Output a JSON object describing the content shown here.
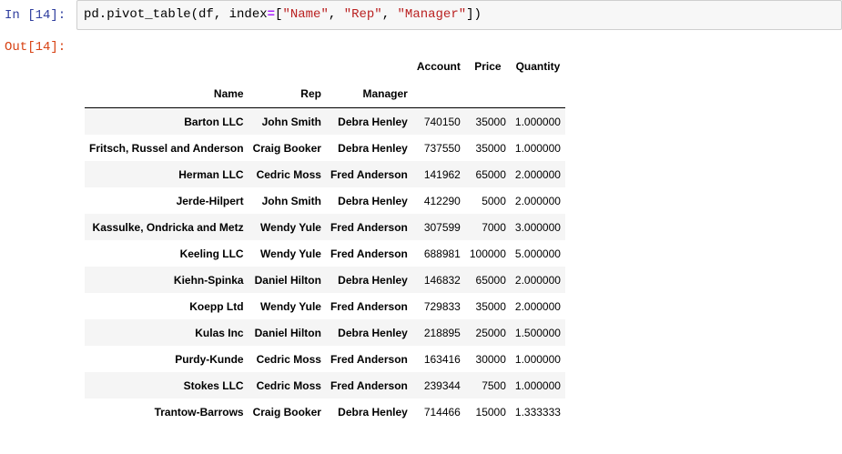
{
  "cell": {
    "in_prompt": "In [14]:",
    "out_prompt": "Out[14]:",
    "code": {
      "t1": "pd.pivot_table(df, index",
      "t2": "=",
      "t3": "[",
      "t4": "\"Name\"",
      "t5": ", ",
      "t6": "\"Rep\"",
      "t7": ", ",
      "t8": "\"Manager\"",
      "t9": "])"
    }
  },
  "table": {
    "value_columns": [
      "Account",
      "Price",
      "Quantity"
    ],
    "index_names": [
      "Name",
      "Rep",
      "Manager"
    ],
    "rows": [
      {
        "name": "Barton LLC",
        "rep": "John Smith",
        "manager": "Debra Henley",
        "account": "740150",
        "price": "35000",
        "quantity": "1.000000"
      },
      {
        "name": "Fritsch, Russel and Anderson",
        "rep": "Craig Booker",
        "manager": "Debra Henley",
        "account": "737550",
        "price": "35000",
        "quantity": "1.000000"
      },
      {
        "name": "Herman LLC",
        "rep": "Cedric Moss",
        "manager": "Fred Anderson",
        "account": "141962",
        "price": "65000",
        "quantity": "2.000000"
      },
      {
        "name": "Jerde-Hilpert",
        "rep": "John Smith",
        "manager": "Debra Henley",
        "account": "412290",
        "price": "5000",
        "quantity": "2.000000"
      },
      {
        "name": "Kassulke, Ondricka and Metz",
        "rep": "Wendy Yule",
        "manager": "Fred Anderson",
        "account": "307599",
        "price": "7000",
        "quantity": "3.000000"
      },
      {
        "name": "Keeling LLC",
        "rep": "Wendy Yule",
        "manager": "Fred Anderson",
        "account": "688981",
        "price": "100000",
        "quantity": "5.000000"
      },
      {
        "name": "Kiehn-Spinka",
        "rep": "Daniel Hilton",
        "manager": "Debra Henley",
        "account": "146832",
        "price": "65000",
        "quantity": "2.000000"
      },
      {
        "name": "Koepp Ltd",
        "rep": "Wendy Yule",
        "manager": "Fred Anderson",
        "account": "729833",
        "price": "35000",
        "quantity": "2.000000"
      },
      {
        "name": "Kulas Inc",
        "rep": "Daniel Hilton",
        "manager": "Debra Henley",
        "account": "218895",
        "price": "25000",
        "quantity": "1.500000"
      },
      {
        "name": "Purdy-Kunde",
        "rep": "Cedric Moss",
        "manager": "Fred Anderson",
        "account": "163416",
        "price": "30000",
        "quantity": "1.000000"
      },
      {
        "name": "Stokes LLC",
        "rep": "Cedric Moss",
        "manager": "Fred Anderson",
        "account": "239344",
        "price": "7500",
        "quantity": "1.000000"
      },
      {
        "name": "Trantow-Barrows",
        "rep": "Craig Booker",
        "manager": "Debra Henley",
        "account": "714466",
        "price": "15000",
        "quantity": "1.333333"
      }
    ]
  }
}
